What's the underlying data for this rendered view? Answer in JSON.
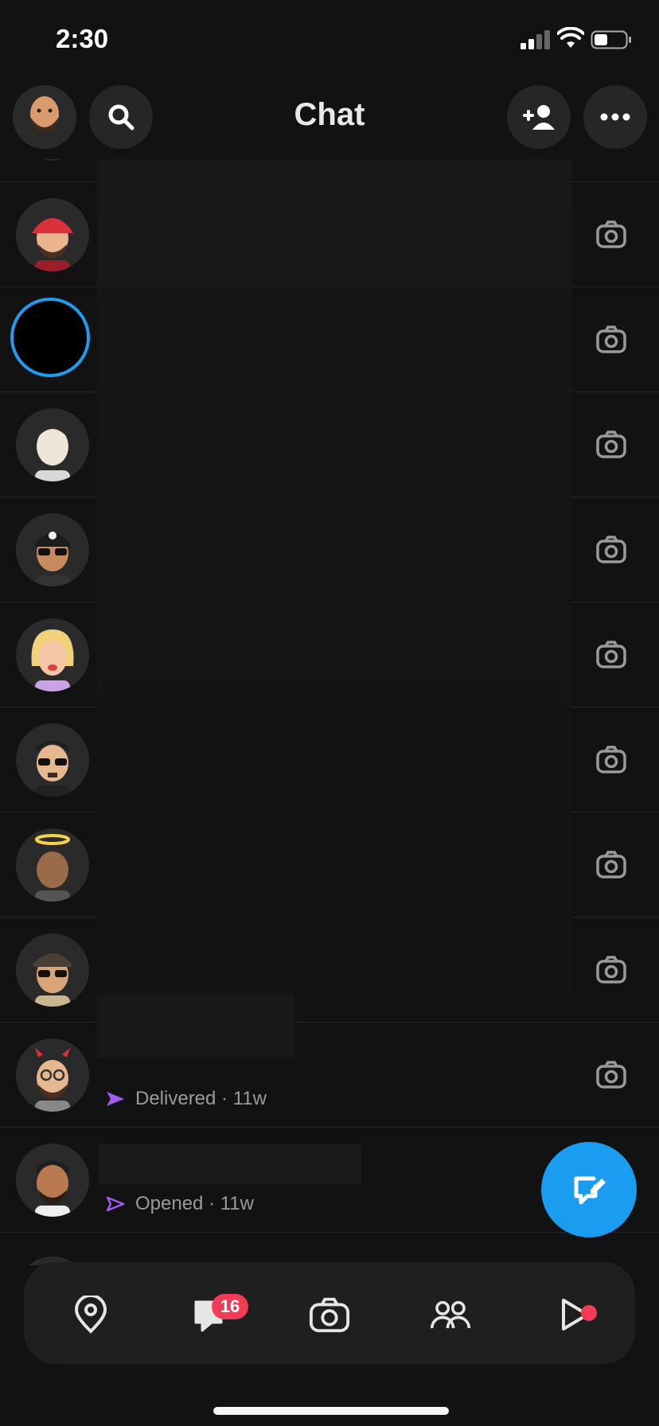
{
  "status_bar": {
    "time": "2:30"
  },
  "header": {
    "title": "Chat"
  },
  "chats": [
    {
      "avatar": "bitmoji-red-cap-beard",
      "status": "",
      "time": ""
    },
    {
      "avatar": "story-ring",
      "status": "",
      "time": ""
    },
    {
      "avatar": "bitmoji-pale-man",
      "status": "",
      "time": ""
    },
    {
      "avatar": "bitmoji-skull-cap-sunglasses",
      "status": "",
      "time": ""
    },
    {
      "avatar": "bitmoji-blonde-woman",
      "status": "",
      "time": ""
    },
    {
      "avatar": "bitmoji-sunglasses-goatee",
      "status": "",
      "time": ""
    },
    {
      "avatar": "bitmoji-halo",
      "status": "",
      "time": ""
    },
    {
      "avatar": "bitmoji-cap-sunglasses",
      "status": "",
      "time": ""
    },
    {
      "avatar": "bitmoji-devil-horns-glasses",
      "status": "Delivered",
      "time": "11w"
    },
    {
      "avatar": "bitmoji-dark-hair-beard",
      "status": "Opened",
      "time": "11w"
    }
  ],
  "status_labels": {
    "delivered": "Delivered · 11w",
    "opened": "Opened · 11w"
  },
  "nav": {
    "chat_badge": "16",
    "items": [
      "map-icon",
      "chat-icon",
      "camera-icon",
      "friends-icon",
      "stories-icon"
    ]
  },
  "colors": {
    "accent": "#1a9cf0",
    "badge": "#f23c57",
    "sent_arrow": "#a05cf0",
    "background": "#121212"
  }
}
